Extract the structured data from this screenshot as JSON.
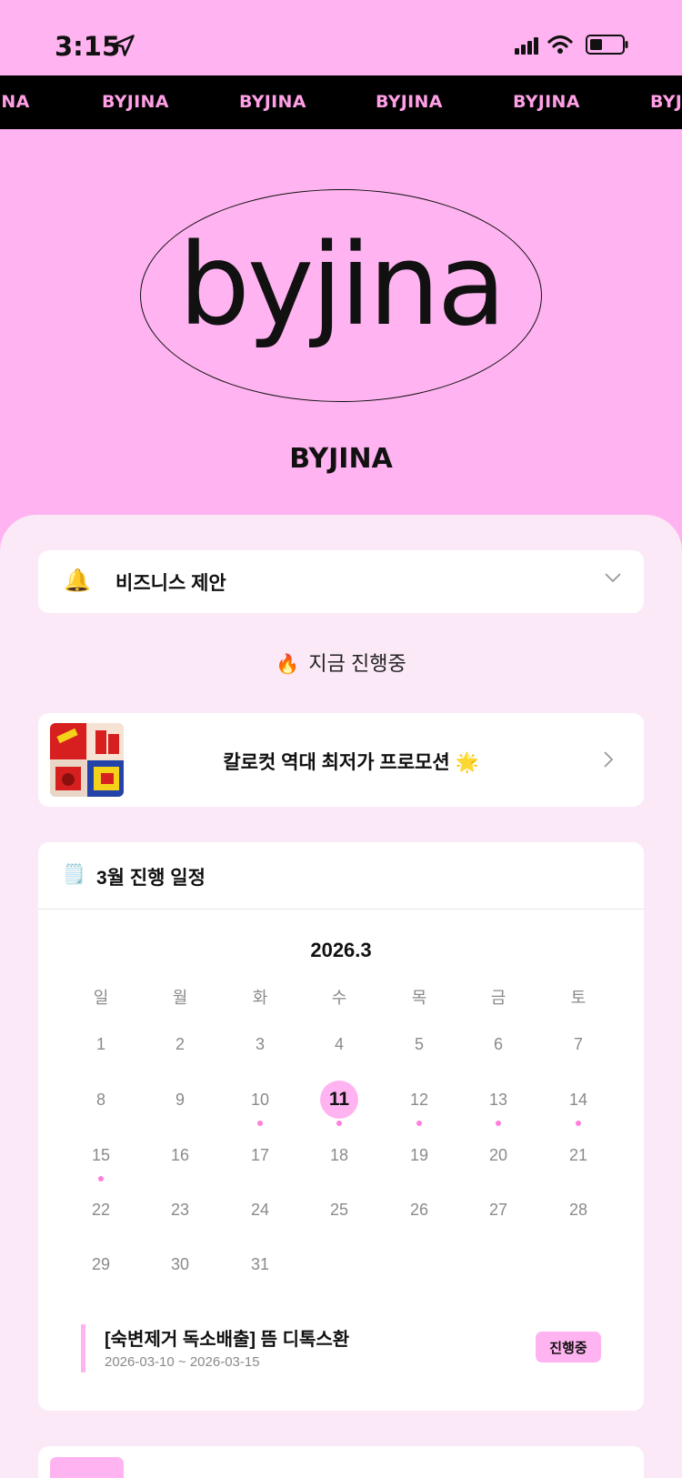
{
  "status_bar": {
    "time": "3:15",
    "icons": [
      "location-arrow-icon",
      "cellular-signal-icon",
      "wifi-icon",
      "battery-icon"
    ]
  },
  "marquee": {
    "items": [
      "INA",
      "BYJINA",
      "BYJINA",
      "BYJINA",
      "BYJINA",
      "BYJ"
    ]
  },
  "hero": {
    "logo_text": "byjina",
    "brand_name": "BYJINA"
  },
  "business": {
    "icon": "bell-icon",
    "label": "비즈니스 제안"
  },
  "now": {
    "icon": "fire-icon",
    "label": "지금 진행중"
  },
  "promo": {
    "title": "칼로컷 역대 최저가 프로모션 🌟"
  },
  "schedule": {
    "icon": "notepad-icon",
    "title": "3월 진행 일정",
    "calendar_title": "2026.3",
    "weekdays": [
      "일",
      "월",
      "화",
      "수",
      "목",
      "금",
      "토"
    ],
    "weeks": [
      [
        "1",
        "2",
        "3",
        "4",
        "5",
        "6",
        "7"
      ],
      [
        "8",
        "9",
        "10",
        "11",
        "12",
        "13",
        "14"
      ],
      [
        "15",
        "16",
        "17",
        "18",
        "19",
        "20",
        "21"
      ],
      [
        "22",
        "23",
        "24",
        "25",
        "26",
        "27",
        "28"
      ],
      [
        "29",
        "30",
        "31",
        "",
        "",
        "",
        ""
      ]
    ],
    "today": "11",
    "event_days": [
      "10",
      "11",
      "12",
      "13",
      "14",
      "15"
    ],
    "event": {
      "title": "[숙변제거 독소배출] 뜸 디톡스환",
      "dates": "2026-03-10 ~ 2026-03-15",
      "status": "진행중"
    }
  },
  "colors": {
    "brand_pink": "#ffb3f0",
    "panel_bg": "#fbe9f8",
    "marquee_text": "#ff9fe6",
    "event_dot": "#ff7fdb"
  }
}
